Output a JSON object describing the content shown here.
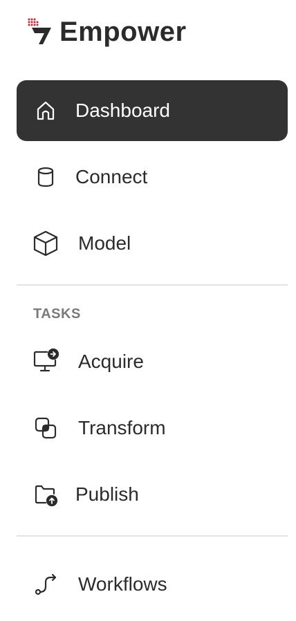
{
  "brand": {
    "name": "Empower",
    "accent": "#e11d2a"
  },
  "nav": {
    "dashboard": {
      "label": "Dashboard",
      "icon": "home-icon",
      "active": true
    },
    "connect": {
      "label": "Connect",
      "icon": "database-icon"
    },
    "model": {
      "label": "Model",
      "icon": "cube-icon"
    }
  },
  "tasks": {
    "heading": "TASKS",
    "acquire": {
      "label": "Acquire",
      "icon": "monitor-arrow-icon"
    },
    "transform": {
      "label": "Transform",
      "icon": "overlap-squares-icon"
    },
    "publish": {
      "label": "Publish",
      "icon": "folder-upload-icon"
    }
  },
  "bottom": {
    "workflows": {
      "label": "Workflows",
      "icon": "route-icon"
    }
  },
  "colors": {
    "active_bg": "#333333",
    "text": "#2b2b2b",
    "section_label": "#7a7a7a",
    "divider": "#e4e4e4"
  }
}
